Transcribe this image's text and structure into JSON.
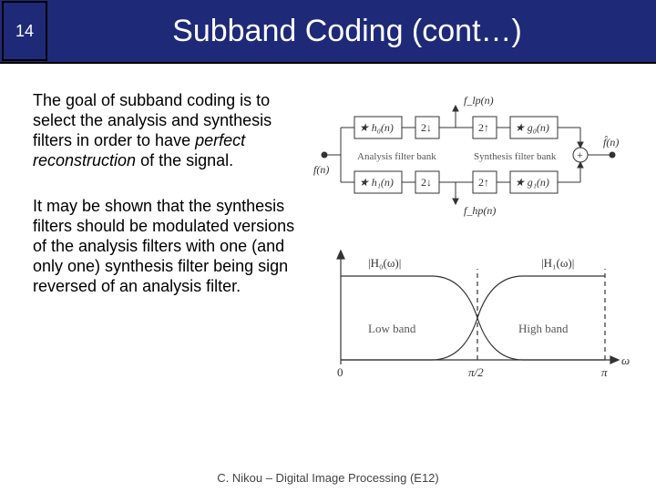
{
  "slide_number": "14",
  "title": "Subband Coding (cont…)",
  "para1_a": "The goal of subband coding is to select the analysis and synthesis filters in order to have ",
  "para1_em": "perfect reconstruction",
  "para1_b": " of the signal.",
  "para2": "It may be shown that the synthesis filters should be modulated versions of the analysis filters with one (and only one) synthesis filter being sign reversed of an analysis filter.",
  "footer": "C. Nikou – Digital Image Processing (E12)",
  "diagram": {
    "input": "f(n)",
    "top_label": "f_lp(n)",
    "bottom_label": "f_hp(n)",
    "h0": "★ h₀(n)",
    "h1": "★ h₁(n)",
    "g0": "★ g₀(n)",
    "g1": "★ g₁(n)",
    "down": "2↓",
    "up": "2↑",
    "analysis": "Analysis filter bank",
    "synthesis": "Synthesis filter bank",
    "plus": "+",
    "output": "f̂(n)"
  },
  "chart_data": {
    "type": "line",
    "title": "",
    "xlabel": "ω",
    "ylabel": "",
    "xlim": [
      0,
      3.1416
    ],
    "ylim": [
      0,
      1
    ],
    "xticks": [
      "0",
      "π/2",
      "π"
    ],
    "series": [
      {
        "name": "|H₀(ω)|",
        "region": "Low band",
        "x": [
          0,
          1.2,
          1.5708,
          1.94,
          3.1416
        ],
        "y": [
          1,
          1,
          0.5,
          0,
          0
        ]
      },
      {
        "name": "|H₁(ω)|",
        "region": "High band",
        "x": [
          0,
          1.2,
          1.5708,
          1.94,
          3.1416
        ],
        "y": [
          0,
          0,
          0.5,
          1,
          1
        ]
      }
    ]
  }
}
